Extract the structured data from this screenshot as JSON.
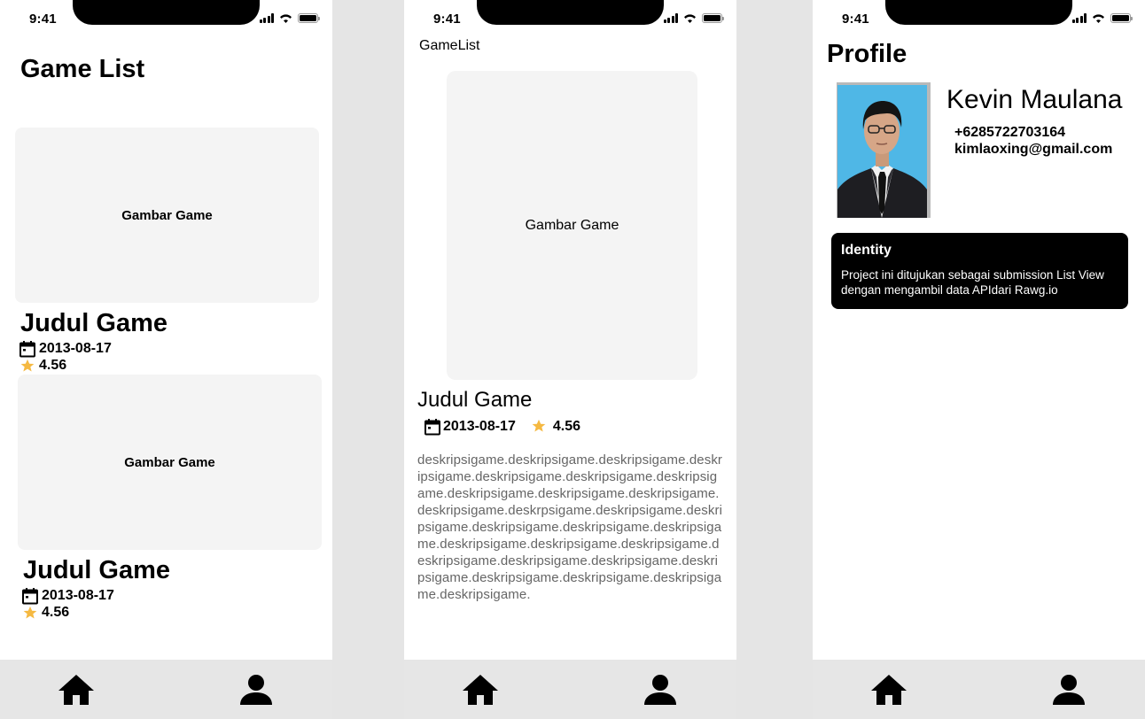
{
  "status_bar": {
    "time": "9:41"
  },
  "game_list": {
    "title": "Game List",
    "cards": [
      {
        "image_label": "Gambar Game",
        "title": "Judul Game",
        "date": "2013-08-17",
        "rating": "4.56"
      },
      {
        "image_label": "Gambar Game",
        "title": "Judul Game",
        "date": "2013-08-17",
        "rating": "4.56"
      }
    ]
  },
  "detail": {
    "header": "GameList",
    "image_label": "Gambar Game",
    "title": "Judul Game",
    "date": "2013-08-17",
    "rating": "4.56",
    "description": "deskripsigame.deskripsigame.deskripsigame.deskripsigame.deskripsigame.deskripsigame.deskripsigame.deskripsigame.deskripsigame.deskripsigame.deskripsigame.deskrpsigame.deskripsigame.deskripsigame.deskripsigame.deskripsigame.deskripsigame.deskripsigame.deskripsigame.deskripsigame.deskripsigame.deskripsigame.deskripsigame.deskripsigame.deskripsigame.deskripsigame.deskripsigame.deskripsigame."
  },
  "profile": {
    "title": "Profile",
    "name": "Kevin Maulana",
    "phone": "+6285722703164",
    "email": "kimlaoxing@gmail.com",
    "identity_title": "Identity",
    "identity_body": "Project ini ditujukan sebagai submission List View dengan mengambil data  APIdari Rawg.io"
  },
  "nav": {
    "items": [
      "home-icon",
      "profile-icon"
    ]
  },
  "colors": {
    "star": "#f5b942",
    "card_bg": "#f4f4f4",
    "nav_bg": "#e6e6e6",
    "photo_bg": "#4fb7e6"
  }
}
